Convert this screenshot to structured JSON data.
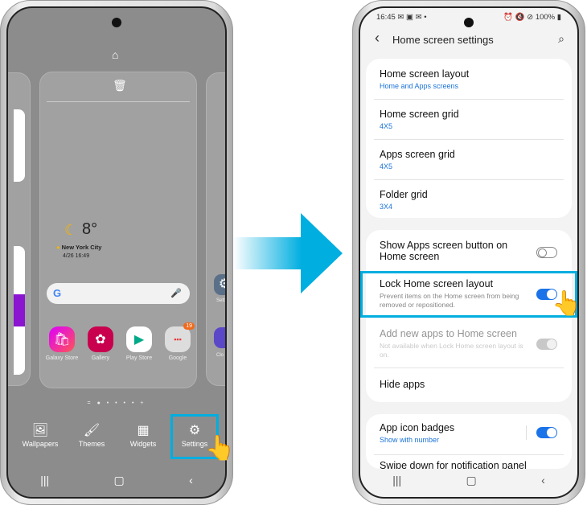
{
  "colors": {
    "accent": "#00aee0",
    "toggle_on": "#1a73e8",
    "link": "#1a73d9"
  },
  "left_phone": {
    "top_icon": "home-icon",
    "trash_icon": "trash-icon",
    "weather": {
      "temp": "8°",
      "city": "New York City",
      "updated": "4/26 16:49"
    },
    "apps": [
      {
        "label": "Galaxy Store"
      },
      {
        "label": "Gallery"
      },
      {
        "label": "Play Store"
      },
      {
        "label": "Google",
        "badge": "19"
      }
    ],
    "side_app_labels": [
      "Setti",
      "Clo"
    ],
    "page_indicator": "= ● • • • • +",
    "toolbar": [
      {
        "label": "Wallpapers",
        "icon": "wallpaper-icon"
      },
      {
        "label": "Themes",
        "icon": "brush-icon"
      },
      {
        "label": "Widgets",
        "icon": "widgets-icon"
      },
      {
        "label": "Settings",
        "icon": "gear-icon",
        "highlighted": true
      }
    ]
  },
  "right_phone": {
    "status": {
      "time": "16:45",
      "battery": "100%"
    },
    "header": {
      "title": "Home screen settings"
    },
    "group1": [
      {
        "title": "Home screen layout",
        "sub": "Home and Apps screens"
      },
      {
        "title": "Home screen grid",
        "sub": "4X5"
      },
      {
        "title": "Apps screen grid",
        "sub": "4X5"
      },
      {
        "title": "Folder grid",
        "sub": "3X4"
      }
    ],
    "group2": [
      {
        "title": "Show Apps screen button on Home screen",
        "toggle": "off"
      },
      {
        "title": "Lock Home screen layout",
        "desc": "Prevent items on the Home screen from being removed or repositioned.",
        "toggle": "on",
        "highlighted": true
      },
      {
        "title": "Add new apps to Home screen",
        "desc": "Not available when Lock Home screen layout is on.",
        "toggle": "disabled"
      },
      {
        "title": "Hide apps"
      }
    ],
    "group3": [
      {
        "title": "App icon badges",
        "sub": "Show with number",
        "toggle": "on"
      },
      {
        "title": "Swipe down for notification panel"
      }
    ]
  }
}
